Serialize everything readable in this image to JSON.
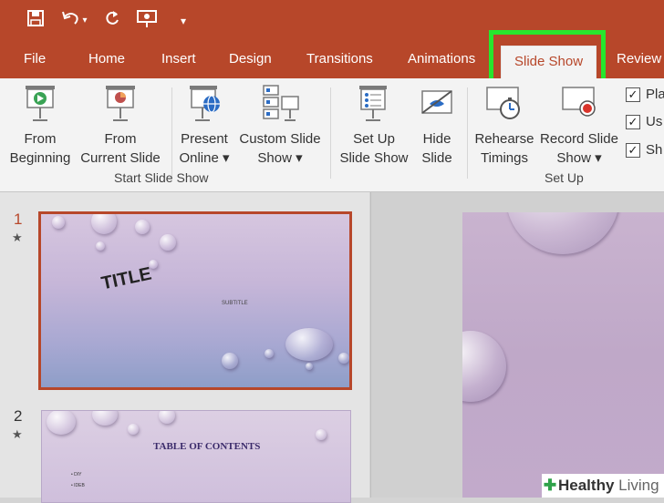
{
  "tabs": [
    "File",
    "Home",
    "Insert",
    "Design",
    "Transitions",
    "Animations",
    "Slide Show",
    "Review"
  ],
  "ribbon": {
    "from_beginning": [
      "From",
      "Beginning"
    ],
    "from_current": [
      "From",
      "Current Slide"
    ],
    "present_online": [
      "Present",
      "Online ▾"
    ],
    "custom_slide_show": [
      "Custom Slide",
      "Show ▾"
    ],
    "set_up": [
      "Set Up",
      "Slide Show"
    ],
    "hide_slide": [
      "Hide",
      "Slide"
    ],
    "rehearse": [
      "Rehearse",
      "Timings"
    ],
    "record": [
      "Record Slide",
      "Show ▾"
    ],
    "group_start": "Start Slide Show",
    "group_setup": "Set Up",
    "checkboxes": [
      "Pla",
      "Us",
      "Sh"
    ]
  },
  "slides": [
    {
      "number": "1",
      "title": "TITLE",
      "subtitle": "SUBTITLE"
    },
    {
      "number": "2",
      "title": "TABLE OF CONTENTS",
      "bullets": [
        "DIY",
        "IDEB"
      ]
    }
  ],
  "watermark": {
    "brand": "Healthy",
    "suffix": "Living"
  },
  "colors": {
    "accent": "#b7472a",
    "highlight": "#27e62d"
  }
}
